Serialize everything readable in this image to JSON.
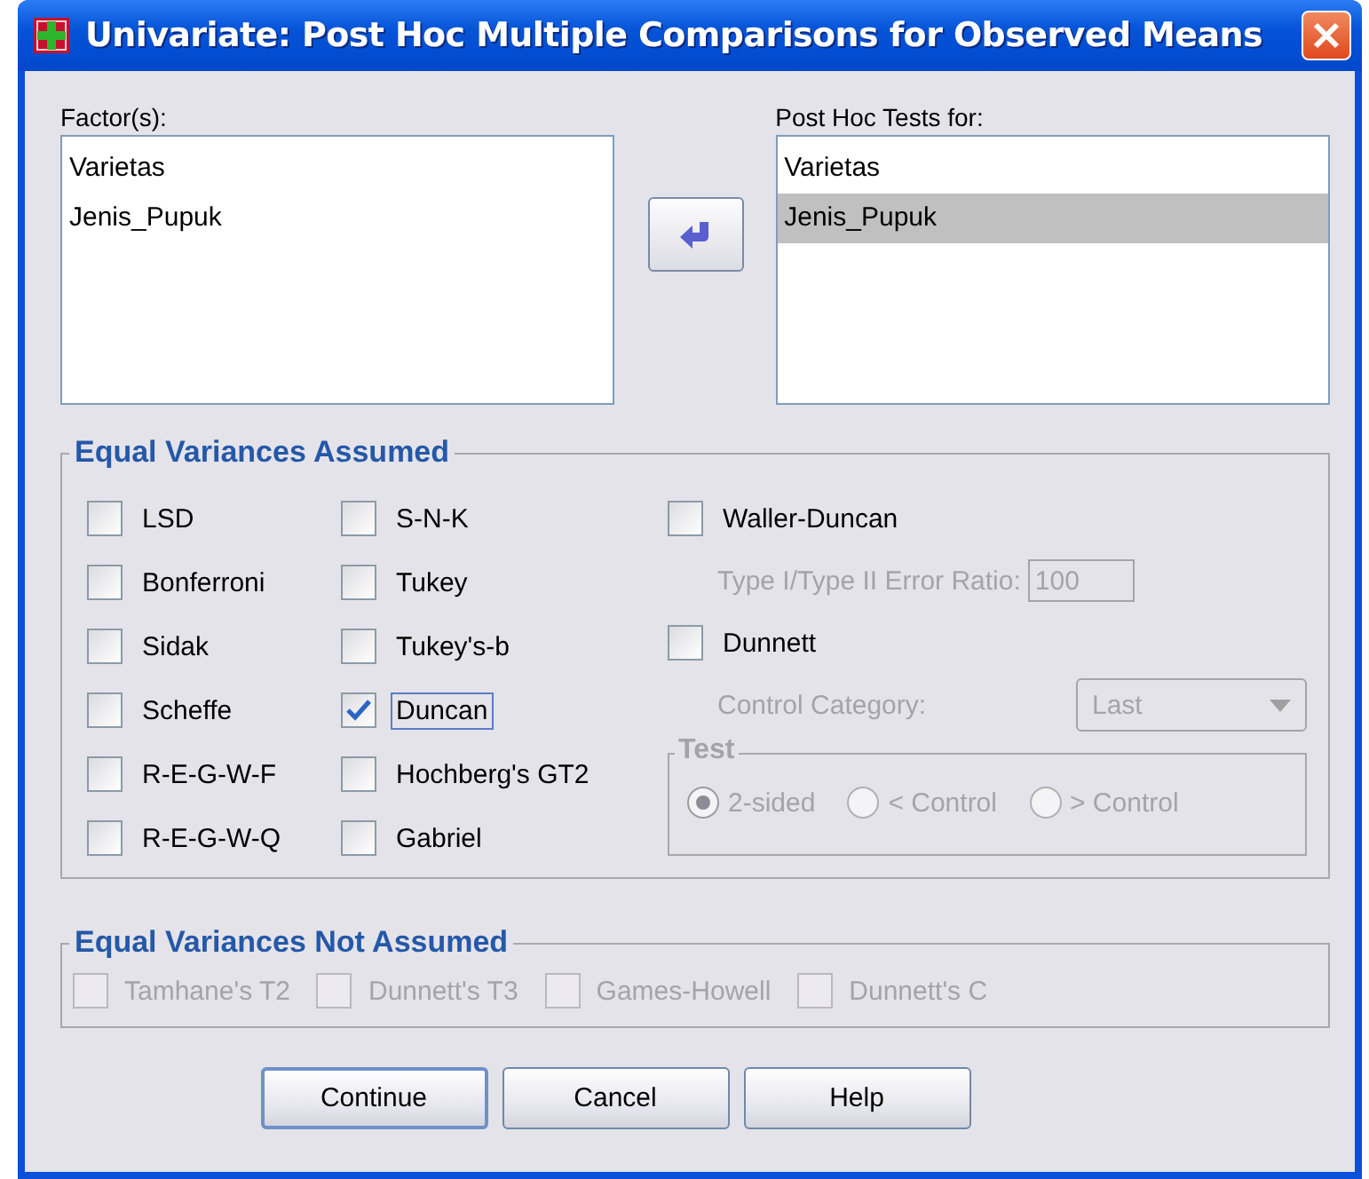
{
  "window": {
    "title": "Univariate: Post Hoc Multiple Comparisons for Observed Means"
  },
  "factors": {
    "label": "Factor(s):",
    "items": [
      {
        "text": "Varietas",
        "selected": false
      },
      {
        "text": "Jenis_Pupuk",
        "selected": false
      }
    ]
  },
  "post_hoc_tests": {
    "label": "Post Hoc Tests for:",
    "items": [
      {
        "text": "Varietas",
        "selected": false
      },
      {
        "text": "Jenis_Pupuk",
        "selected": true
      }
    ]
  },
  "equal_variances_assumed": {
    "title": "Equal Variances Assumed",
    "tests": [
      {
        "label": "LSD",
        "checked": false,
        "focused": false
      },
      {
        "label": "Bonferroni",
        "checked": false,
        "focused": false
      },
      {
        "label": "Sidak",
        "checked": false,
        "focused": false
      },
      {
        "label": "Scheffe",
        "checked": false,
        "focused": false
      },
      {
        "label": "R-E-G-W-F",
        "checked": false,
        "focused": false
      },
      {
        "label": "R-E-G-W-Q",
        "checked": false,
        "focused": false
      },
      {
        "label": "S-N-K",
        "checked": false,
        "focused": false
      },
      {
        "label": "Tukey",
        "checked": false,
        "focused": false
      },
      {
        "label": "Tukey's-b",
        "checked": false,
        "focused": false
      },
      {
        "label": "Duncan",
        "checked": true,
        "focused": true
      },
      {
        "label": "Hochberg's GT2",
        "checked": false,
        "focused": false
      },
      {
        "label": "Gabriel",
        "checked": false,
        "focused": false
      }
    ],
    "waller_duncan": {
      "label": "Waller-Duncan",
      "checked": false
    },
    "error_ratio": {
      "label": "Type I/Type II Error Ratio:",
      "value": "100",
      "disabled": true
    },
    "dunnett": {
      "label": "Dunnett",
      "checked": false
    },
    "control_category": {
      "label": "Control Category:",
      "value": "Last",
      "disabled": true
    },
    "test": {
      "title": "Test",
      "disabled": true,
      "options": [
        {
          "label": "2-sided",
          "selected": true
        },
        {
          "label": "< Control",
          "selected": false
        },
        {
          "label": "> Control",
          "selected": false
        }
      ]
    }
  },
  "equal_variances_not_assumed": {
    "title": "Equal Variances Not Assumed",
    "tests": [
      {
        "label": "Tamhane's T2",
        "checked": false,
        "disabled": true
      },
      {
        "label": "Dunnett's T3",
        "checked": false,
        "disabled": true
      },
      {
        "label": "Games-Howell",
        "checked": false,
        "disabled": true
      },
      {
        "label": "Dunnett's C",
        "checked": false,
        "disabled": true
      }
    ]
  },
  "buttons": [
    {
      "label": "Continue",
      "default": true
    },
    {
      "label": "Cancel",
      "default": false
    },
    {
      "label": "Help",
      "default": false
    }
  ]
}
